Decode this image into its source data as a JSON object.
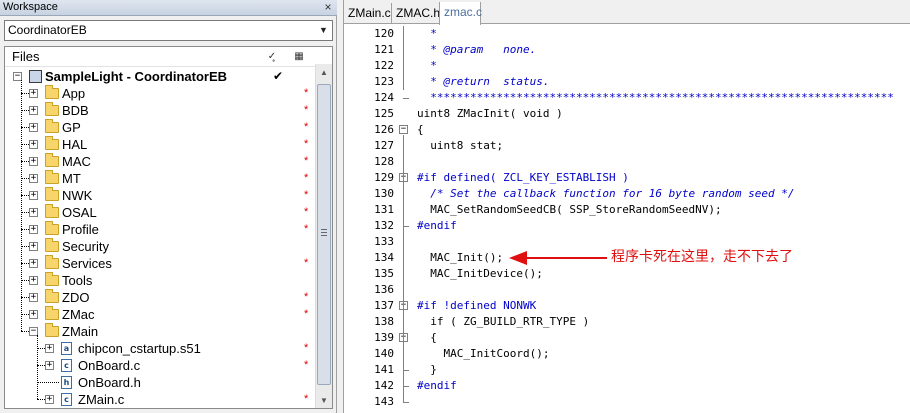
{
  "workspace": {
    "title": "Workspace",
    "close_glyph": "×",
    "configuration": "CoordinatorEB",
    "files_header": "Files",
    "header_icons": [
      "check-settings-icon",
      "build-config-icon"
    ],
    "tree": [
      {
        "label": "SampleLight - CoordinatorEB",
        "type": "project",
        "expander": "−",
        "check": "✔"
      },
      {
        "label": "App",
        "type": "folder",
        "expander": "+",
        "mark": "*"
      },
      {
        "label": "BDB",
        "type": "folder",
        "expander": "+",
        "mark": "*"
      },
      {
        "label": "GP",
        "type": "folder",
        "expander": "+",
        "mark": "*"
      },
      {
        "label": "HAL",
        "type": "folder",
        "expander": "+",
        "mark": "*"
      },
      {
        "label": "MAC",
        "type": "folder",
        "expander": "+",
        "mark": "*"
      },
      {
        "label": "MT",
        "type": "folder",
        "expander": "+",
        "mark": "*"
      },
      {
        "label": "NWK",
        "type": "folder",
        "expander": "+",
        "mark": "*"
      },
      {
        "label": "OSAL",
        "type": "folder",
        "expander": "+",
        "mark": "*"
      },
      {
        "label": "Profile",
        "type": "folder",
        "expander": "+",
        "mark": "*"
      },
      {
        "label": "Security",
        "type": "folder",
        "expander": "+",
        "mark": ""
      },
      {
        "label": "Services",
        "type": "folder",
        "expander": "+",
        "mark": "*"
      },
      {
        "label": "Tools",
        "type": "folder",
        "expander": "+",
        "mark": ""
      },
      {
        "label": "ZDO",
        "type": "folder",
        "expander": "+",
        "mark": "*"
      },
      {
        "label": "ZMac",
        "type": "folder",
        "expander": "+",
        "mark": "*"
      },
      {
        "label": "ZMain",
        "type": "folder",
        "expander": "−",
        "mark": ""
      },
      {
        "label": "chipcon_cstartup.s51",
        "type": "asm",
        "expander": "+",
        "mark": "*"
      },
      {
        "label": "OnBoard.c",
        "type": "cfile",
        "expander": "+",
        "mark": "*"
      },
      {
        "label": "OnBoard.h",
        "type": "hfile",
        "expander": "",
        "mark": ""
      },
      {
        "label": "ZMain.c",
        "type": "cfile",
        "expander": "+",
        "mark": "*"
      }
    ]
  },
  "editor": {
    "tabs": [
      {
        "label": "ZMain.c",
        "active": false
      },
      {
        "label": "ZMAC.h",
        "active": false
      },
      {
        "label": "zmac.c",
        "active": true
      }
    ],
    "lines": [
      {
        "n": "120",
        "text": "  *",
        "kind": "cmt"
      },
      {
        "n": "121",
        "text": "  * @param   none.",
        "kind": "cmt"
      },
      {
        "n": "122",
        "text": "  *",
        "kind": "cmt"
      },
      {
        "n": "123",
        "text": "  * @return  status.",
        "kind": "cmt"
      },
      {
        "n": "124",
        "text": "  **********************************************************************",
        "kind": "cmt"
      },
      {
        "n": "125",
        "text": "uint8 ZMacInit( void )",
        "kind": "code"
      },
      {
        "n": "126",
        "text": "{",
        "kind": "code"
      },
      {
        "n": "127",
        "text": "  uint8 stat;",
        "kind": "code"
      },
      {
        "n": "128",
        "text": "",
        "kind": "code"
      },
      {
        "n": "129",
        "text": "#if defined( ZCL_KEY_ESTABLISH )",
        "kind": "pp"
      },
      {
        "n": "130",
        "text": "  /* Set the callback function for 16 byte random seed */",
        "kind": "cmt"
      },
      {
        "n": "131",
        "text": "  MAC_SetRandomSeedCB( SSP_StoreRandomSeedNV);",
        "kind": "code"
      },
      {
        "n": "132",
        "text": "#endif",
        "kind": "pp"
      },
      {
        "n": "133",
        "text": "",
        "kind": "code"
      },
      {
        "n": "134",
        "text": "  MAC_Init();",
        "kind": "code"
      },
      {
        "n": "135",
        "text": "  MAC_InitDevice();",
        "kind": "code"
      },
      {
        "n": "136",
        "text": "",
        "kind": "code"
      },
      {
        "n": "137",
        "text": "#if !defined NONWK",
        "kind": "pp"
      },
      {
        "n": "138",
        "text": "  if ( ZG_BUILD_RTR_TYPE )",
        "kind": "code"
      },
      {
        "n": "139",
        "text": "  {",
        "kind": "code"
      },
      {
        "n": "140",
        "text": "    MAC_InitCoord();",
        "kind": "code"
      },
      {
        "n": "141",
        "text": "  }",
        "kind": "code"
      },
      {
        "n": "142",
        "text": "#endif",
        "kind": "pp"
      },
      {
        "n": "143",
        "text": "",
        "kind": "code"
      }
    ],
    "annotation": {
      "text": "程序卡死在这里，走不下去了",
      "color": "#e01010"
    }
  },
  "colors": {
    "comment": "#0000c8",
    "preprocessor": "#0000c8",
    "modified_mark": "#e00000",
    "active_tab": "#4a6fa0"
  }
}
